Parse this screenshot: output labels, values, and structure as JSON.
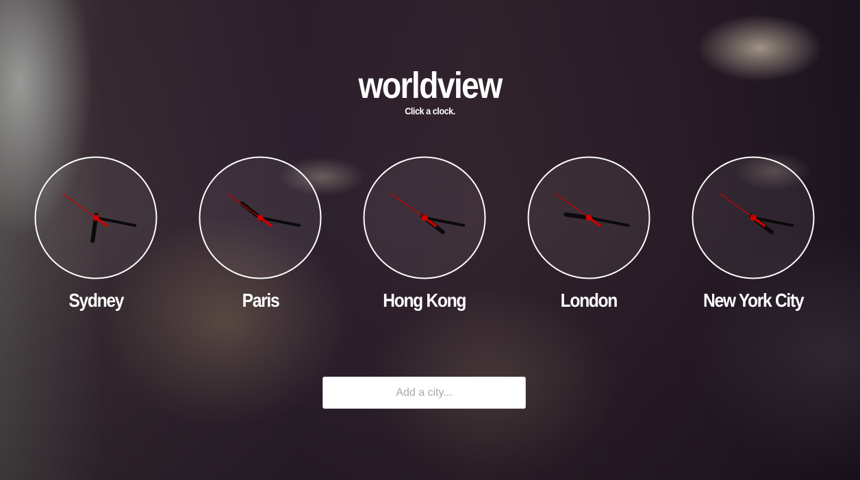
{
  "app": {
    "title": "worldview",
    "subtitle": "Click a clock."
  },
  "clocks": [
    {
      "city": "Sydney",
      "time": {
        "h": 6,
        "m": 16,
        "s": 51
      }
    },
    {
      "city": "Paris",
      "time": {
        "h": 10,
        "m": 16,
        "s": 51
      }
    },
    {
      "city": "Hong Kong",
      "time": {
        "h": 4,
        "m": 16,
        "s": 51
      }
    },
    {
      "city": "London",
      "time": {
        "h": 9,
        "m": 16,
        "s": 51
      }
    },
    {
      "city": "New York City",
      "time": {
        "h": 4,
        "m": 16,
        "s": 51
      }
    }
  ],
  "add_city": {
    "placeholder": "Add a city...",
    "value": ""
  },
  "colors": {
    "face_border": "#ffffff",
    "hour_hand": "#0a0a0a",
    "minute_hand": "#0a0a0a",
    "second_hand": "#cc0000",
    "text": "#ffffff"
  }
}
